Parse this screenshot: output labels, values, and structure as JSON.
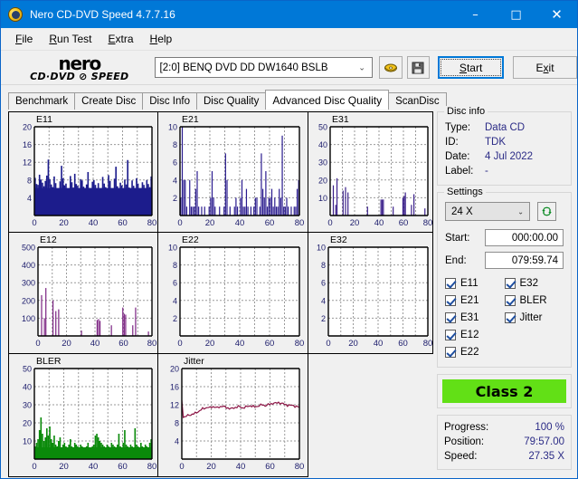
{
  "window": {
    "title": "Nero CD-DVD Speed 4.7.7.16",
    "icon": "nero-disc-icon",
    "minimize": "–",
    "maximize": "□",
    "close": "✕"
  },
  "menubar": {
    "items": [
      {
        "label": "File",
        "accel": "F"
      },
      {
        "label": "Run Test",
        "accel": "R"
      },
      {
        "label": "Extra",
        "accel": "E"
      },
      {
        "label": "Help",
        "accel": "H"
      }
    ]
  },
  "toolbar": {
    "logo_word": "nero",
    "logo_sub": "CD·DVD ⊘ SPEED",
    "drive_value": "[2:0]   BENQ DVD DD DW1640 BSLB",
    "drive_chevron": "⌄",
    "eject_icon": "disc-eject-icon",
    "save_icon": "floppy-save-icon",
    "start_label": "Start",
    "exit_label": "Exit"
  },
  "tabs": [
    {
      "label": "Benchmark",
      "active": false
    },
    {
      "label": "Create Disc",
      "active": false
    },
    {
      "label": "Disc Info",
      "active": false
    },
    {
      "label": "Disc Quality",
      "active": false
    },
    {
      "label": "Advanced Disc Quality",
      "active": true
    },
    {
      "label": "ScanDisc",
      "active": false
    }
  ],
  "disc_info": {
    "legend": "Disc info",
    "rows": [
      {
        "key": "Type:",
        "value": "Data CD"
      },
      {
        "key": "ID:",
        "value": "TDK"
      },
      {
        "key": "Date:",
        "value": "4 Jul 2022"
      },
      {
        "key": "Label:",
        "value": "-"
      }
    ]
  },
  "settings": {
    "legend": "Settings",
    "speed_value": "24 X",
    "speed_chevron": "⌄",
    "refresh_icon": "refresh-icon",
    "start_label": "Start:",
    "start_value": "000:00.00",
    "end_label": "End:",
    "end_value": "079:59.74",
    "checks_left": [
      {
        "label": "E11",
        "checked": true
      },
      {
        "label": "E21",
        "checked": true
      },
      {
        "label": "E31",
        "checked": true
      },
      {
        "label": "E12",
        "checked": true
      },
      {
        "label": "E22",
        "checked": true
      }
    ],
    "checks_right": [
      {
        "label": "E32",
        "checked": true
      },
      {
        "label": "BLER",
        "checked": true
      },
      {
        "label": "Jitter",
        "checked": true
      }
    ]
  },
  "result": {
    "class_label": "Class 2",
    "class_color": "#62e016",
    "progress_key": "Progress:",
    "progress_value": "100 %",
    "position_key": "Position:",
    "position_value": "79:57.00",
    "speed_key": "Speed:",
    "speed_value": "27.35 X"
  },
  "chart_data": [
    {
      "id": "e11",
      "type": "area",
      "title": "E11",
      "color": "#1c1c8c",
      "xlabel": "",
      "ylabel": "",
      "xlim": [
        0,
        80
      ],
      "ylim": [
        0,
        20
      ],
      "xticks": [
        0,
        20,
        40,
        60,
        80
      ],
      "yticks": [
        4,
        8,
        12,
        16,
        20
      ],
      "grid": true,
      "baseline_mean": 6.2,
      "values": [
        8.5,
        7.1,
        6.9,
        9.2,
        8.1,
        7.4,
        6.6,
        7.8,
        9.0,
        12.6,
        8.2,
        7.0,
        6.4,
        8.8,
        7.3,
        6.1,
        5.9,
        7.7,
        11.2,
        8.4,
        6.8,
        7.2,
        6.0,
        5.6,
        8.9,
        7.5,
        6.3,
        9.4,
        7.1,
        6.7,
        5.8,
        8.2,
        7.9,
        6.5,
        5.4,
        7.0,
        9.8,
        6.2,
        5.1,
        7.6,
        8.0,
        6.9,
        5.5,
        7.3,
        6.1,
        4.9,
        8.7,
        7.2,
        6.4,
        5.2,
        9.1,
        7.8,
        6.0,
        5.7,
        8.3,
        11.0,
        6.6,
        5.3,
        7.4,
        6.8,
        5.9,
        8.1,
        7.0,
        12.5,
        6.3,
        5.5,
        7.9,
        6.7,
        5.0,
        8.4,
        7.2,
        6.1,
        5.6,
        7.5,
        6.9,
        5.8,
        8.0,
        7.1,
        6.4,
        8.8
      ]
    },
    {
      "id": "e21",
      "type": "bar",
      "title": "E21",
      "color": "#2a1b8e",
      "xlim": [
        0,
        80
      ],
      "ylim": [
        0,
        10
      ],
      "xticks": [
        0,
        20,
        40,
        60,
        80
      ],
      "yticks": [
        2,
        4,
        6,
        8,
        10
      ],
      "grid": true,
      "values": [
        2,
        10,
        4,
        4,
        1,
        0,
        4,
        1,
        1,
        1,
        3,
        5,
        1,
        0,
        1,
        0,
        1,
        0,
        0,
        1,
        2,
        5,
        2,
        1,
        0,
        0,
        1,
        0,
        0,
        1,
        7,
        4,
        0,
        1,
        0,
        0,
        1,
        2,
        1,
        0,
        2,
        4,
        1,
        1,
        3,
        1,
        0,
        1,
        0,
        1,
        2,
        2,
        0,
        1,
        7,
        3,
        2,
        5,
        1,
        2,
        2,
        3,
        1,
        2,
        1,
        1,
        3,
        2,
        9,
        1,
        1,
        2,
        1,
        0,
        1,
        0,
        1,
        1,
        3,
        4
      ]
    },
    {
      "id": "e31",
      "type": "bar",
      "title": "E31",
      "color": "#3a1f8a",
      "xlim": [
        0,
        80
      ],
      "ylim": [
        0,
        50
      ],
      "xticks": [
        0,
        20,
        40,
        60,
        80
      ],
      "yticks": [
        10,
        20,
        30,
        40,
        50
      ],
      "grid": true,
      "values": [
        0,
        0,
        17,
        0,
        6,
        21,
        0,
        0,
        0,
        0,
        14,
        0,
        16,
        0,
        13,
        0,
        0,
        0,
        0,
        0,
        0,
        0,
        0,
        0,
        0,
        0,
        0,
        0,
        0,
        0,
        5,
        0,
        0,
        0,
        0,
        0,
        0,
        0,
        0,
        0,
        0,
        9,
        9,
        9,
        0,
        0,
        0,
        0,
        0,
        0,
        0,
        5,
        0,
        0,
        0,
        0,
        0,
        0,
        0,
        10,
        11,
        13,
        0,
        0,
        0,
        0,
        6,
        0,
        12,
        0,
        0,
        0,
        0,
        0,
        0,
        0,
        0,
        4,
        0,
        0
      ]
    },
    {
      "id": "e12",
      "type": "bar",
      "title": "E12",
      "color": "#7b2382",
      "xlim": [
        0,
        80
      ],
      "ylim": [
        0,
        500
      ],
      "xticks": [
        0,
        20,
        40,
        60,
        80
      ],
      "yticks": [
        100,
        200,
        300,
        400,
        500
      ],
      "grid": true,
      "values": [
        0,
        0,
        230,
        0,
        100,
        270,
        0,
        0,
        0,
        0,
        200,
        0,
        140,
        0,
        150,
        0,
        0,
        0,
        0,
        0,
        0,
        0,
        0,
        0,
        0,
        0,
        0,
        0,
        0,
        0,
        30,
        0,
        0,
        0,
        0,
        0,
        0,
        0,
        0,
        0,
        0,
        90,
        95,
        85,
        0,
        0,
        0,
        0,
        0,
        0,
        0,
        60,
        0,
        0,
        0,
        0,
        0,
        0,
        0,
        160,
        125,
        120,
        0,
        0,
        0,
        0,
        60,
        0,
        160,
        0,
        0,
        0,
        0,
        0,
        0,
        0,
        0,
        25,
        0,
        0
      ]
    },
    {
      "id": "e22",
      "type": "bar",
      "title": "E22",
      "color": "#2a1b8e",
      "xlim": [
        0,
        80
      ],
      "ylim": [
        0,
        10
      ],
      "xticks": [
        0,
        20,
        40,
        60,
        80
      ],
      "yticks": [
        2,
        4,
        6,
        8,
        10
      ],
      "grid": true,
      "values": []
    },
    {
      "id": "e32",
      "type": "bar",
      "title": "E32",
      "color": "#2a1b8e",
      "xlim": [
        0,
        80
      ],
      "ylim": [
        0,
        10
      ],
      "xticks": [
        0,
        20,
        40,
        60,
        80
      ],
      "yticks": [
        2,
        4,
        6,
        8,
        10
      ],
      "grid": true,
      "values": []
    },
    {
      "id": "bler",
      "type": "area",
      "title": "BLER",
      "color": "#0a8a0a",
      "xlim": [
        0,
        80
      ],
      "ylim": [
        0,
        50
      ],
      "xticks": [
        0,
        20,
        40,
        60,
        80
      ],
      "yticks": [
        10,
        20,
        30,
        40,
        50
      ],
      "grid": true,
      "baseline_mean": 6.5,
      "values": [
        7,
        9,
        11,
        16,
        23,
        14,
        10,
        12,
        17,
        13,
        18,
        11,
        9,
        13,
        8,
        7,
        10,
        12,
        6,
        8,
        9,
        7,
        6,
        8,
        11,
        7,
        6,
        9,
        8,
        7,
        6,
        8,
        7,
        6,
        5,
        7,
        9,
        6,
        5,
        7,
        8,
        13,
        14,
        12,
        10,
        9,
        8,
        7,
        6,
        8,
        7,
        6,
        9,
        8,
        7,
        6,
        8,
        14,
        7,
        6,
        9,
        16,
        8,
        7,
        6,
        8,
        7,
        6,
        17,
        8,
        7,
        6,
        9,
        7,
        6,
        8,
        7,
        6,
        9,
        11
      ]
    },
    {
      "id": "jitter",
      "type": "line",
      "title": "Jitter",
      "color": "#8c1445",
      "xlim": [
        0,
        80
      ],
      "ylim": [
        0,
        20
      ],
      "xticks": [
        0,
        20,
        40,
        60,
        80
      ],
      "yticks": [
        4,
        8,
        12,
        16,
        20
      ],
      "grid": true,
      "values": [
        13.0,
        9.4,
        9.3,
        9.5,
        9.6,
        9.7,
        9.8,
        9.9,
        10.0,
        10.1,
        10.3,
        10.5,
        10.7,
        10.9,
        11.1,
        11.2,
        11.3,
        11.4,
        11.4,
        11.3,
        11.5,
        11.6,
        11.5,
        11.4,
        11.3,
        11.5,
        11.6,
        11.7,
        11.6,
        11.5,
        11.4,
        11.3,
        11.2,
        11.1,
        11.2,
        11.3,
        11.4,
        11.5,
        11.6,
        11.5,
        11.4,
        11.3,
        11.4,
        11.5,
        11.6,
        11.7,
        11.8,
        11.7,
        11.6,
        11.5,
        11.6,
        11.7,
        11.8,
        11.9,
        12.0,
        11.9,
        11.8,
        11.9,
        12.0,
        12.1,
        12.2,
        12.3,
        12.4,
        12.3,
        12.4,
        12.5,
        12.4,
        12.3,
        12.2,
        12.1,
        12.0,
        11.9,
        11.9,
        11.8,
        11.9,
        11.8,
        11.7,
        11.6,
        11.5,
        11.4
      ]
    }
  ]
}
